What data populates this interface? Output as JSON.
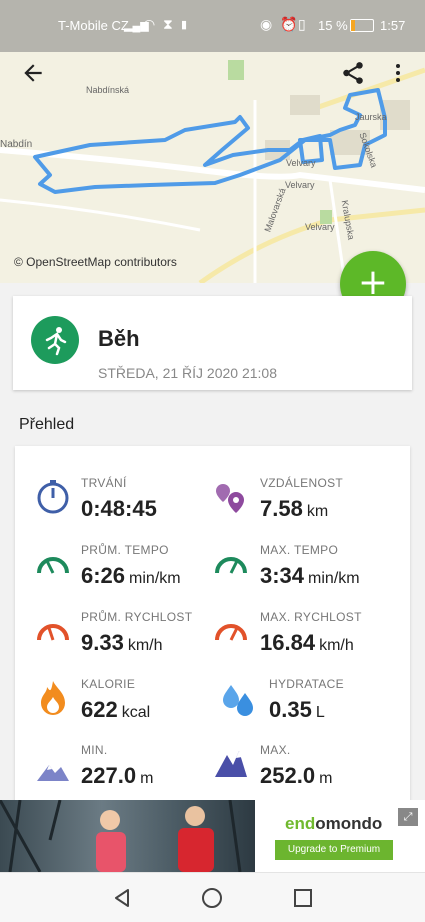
{
  "status_bar": {
    "carrier": "T-Mobile CZ",
    "battery": "15 %",
    "time": "1:57"
  },
  "map": {
    "attribution": "© OpenStreetMap contributors",
    "street_labels": [
      "Nabdínská",
      "Jaurska",
      "Sokolska",
      "Velvary",
      "Malovarská",
      "Velvary",
      "Kralupska",
      "Nabdín",
      "Velvary"
    ]
  },
  "activity": {
    "title": "Běh",
    "datetime": "STŘEDA, 21 ŘÍJ 2020 21:08",
    "icon": "running-icon"
  },
  "overview": {
    "heading": "Přehled",
    "stats": [
      {
        "label": "TRVÁNÍ",
        "value": "0:48:45",
        "unit": "",
        "icon": "stopwatch-icon"
      },
      {
        "label": "VZDÁLENOST",
        "value": "7.58",
        "unit": "km",
        "icon": "location-pins-icon"
      },
      {
        "label": "PRŮM. TEMPO",
        "value": "6:26",
        "unit": "min/km",
        "icon": "pace-gauge-icon"
      },
      {
        "label": "MAX. TEMPO",
        "value": "3:34",
        "unit": "min/km",
        "icon": "pace-gauge-icon"
      },
      {
        "label": "PRŮM. RYCHLOST",
        "value": "9.33",
        "unit": "km/h",
        "icon": "speed-gauge-icon"
      },
      {
        "label": "MAX. RYCHLOST",
        "value": "16.84",
        "unit": "km/h",
        "icon": "speed-gauge-icon"
      },
      {
        "label": "KALORIE",
        "value": "622",
        "unit": "kcal",
        "icon": "flame-icon"
      },
      {
        "label": "HYDRATACE",
        "value": "0.35",
        "unit": "L",
        "icon": "water-drops-icon"
      },
      {
        "label": "MIN.",
        "value": "227.0",
        "unit": "m",
        "icon": "mountain-min-icon"
      },
      {
        "label": "MAX.",
        "value": "252.0",
        "unit": "m",
        "icon": "mountain-max-icon"
      }
    ]
  },
  "ad": {
    "brand_prefix": "end",
    "brand_rest": "omondo",
    "cta": "Upgrade to Premium"
  },
  "colors": {
    "accent_green": "#5db828",
    "activity_green": "#1d9b5c",
    "route_blue": "#4f9be8",
    "pace_green": "#1d8a5c",
    "speed_orange": "#e2522a",
    "distance_purple": "#8e4a9e",
    "flame_orange": "#f28c1e",
    "water_blue": "#3a8fe0",
    "mountain_blue": "#4a4fa8"
  }
}
